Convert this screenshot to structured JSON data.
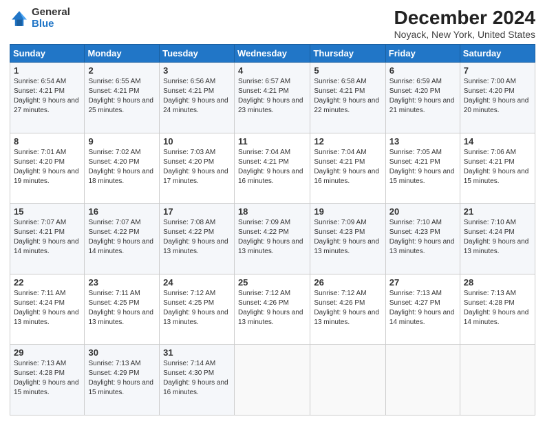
{
  "logo": {
    "general": "General",
    "blue": "Blue"
  },
  "title": "December 2024",
  "subtitle": "Noyack, New York, United States",
  "days_of_week": [
    "Sunday",
    "Monday",
    "Tuesday",
    "Wednesday",
    "Thursday",
    "Friday",
    "Saturday"
  ],
  "weeks": [
    [
      {
        "day": 1,
        "sunrise": "6:54 AM",
        "sunset": "4:21 PM",
        "daylight": "9 hours and 27 minutes."
      },
      {
        "day": 2,
        "sunrise": "6:55 AM",
        "sunset": "4:21 PM",
        "daylight": "9 hours and 25 minutes."
      },
      {
        "day": 3,
        "sunrise": "6:56 AM",
        "sunset": "4:21 PM",
        "daylight": "9 hours and 24 minutes."
      },
      {
        "day": 4,
        "sunrise": "6:57 AM",
        "sunset": "4:21 PM",
        "daylight": "9 hours and 23 minutes."
      },
      {
        "day": 5,
        "sunrise": "6:58 AM",
        "sunset": "4:21 PM",
        "daylight": "9 hours and 22 minutes."
      },
      {
        "day": 6,
        "sunrise": "6:59 AM",
        "sunset": "4:20 PM",
        "daylight": "9 hours and 21 minutes."
      },
      {
        "day": 7,
        "sunrise": "7:00 AM",
        "sunset": "4:20 PM",
        "daylight": "9 hours and 20 minutes."
      }
    ],
    [
      {
        "day": 8,
        "sunrise": "7:01 AM",
        "sunset": "4:20 PM",
        "daylight": "9 hours and 19 minutes."
      },
      {
        "day": 9,
        "sunrise": "7:02 AM",
        "sunset": "4:20 PM",
        "daylight": "9 hours and 18 minutes."
      },
      {
        "day": 10,
        "sunrise": "7:03 AM",
        "sunset": "4:20 PM",
        "daylight": "9 hours and 17 minutes."
      },
      {
        "day": 11,
        "sunrise": "7:04 AM",
        "sunset": "4:21 PM",
        "daylight": "9 hours and 16 minutes."
      },
      {
        "day": 12,
        "sunrise": "7:04 AM",
        "sunset": "4:21 PM",
        "daylight": "9 hours and 16 minutes."
      },
      {
        "day": 13,
        "sunrise": "7:05 AM",
        "sunset": "4:21 PM",
        "daylight": "9 hours and 15 minutes."
      },
      {
        "day": 14,
        "sunrise": "7:06 AM",
        "sunset": "4:21 PM",
        "daylight": "9 hours and 15 minutes."
      }
    ],
    [
      {
        "day": 15,
        "sunrise": "7:07 AM",
        "sunset": "4:21 PM",
        "daylight": "9 hours and 14 minutes."
      },
      {
        "day": 16,
        "sunrise": "7:07 AM",
        "sunset": "4:22 PM",
        "daylight": "9 hours and 14 minutes."
      },
      {
        "day": 17,
        "sunrise": "7:08 AM",
        "sunset": "4:22 PM",
        "daylight": "9 hours and 13 minutes."
      },
      {
        "day": 18,
        "sunrise": "7:09 AM",
        "sunset": "4:22 PM",
        "daylight": "9 hours and 13 minutes."
      },
      {
        "day": 19,
        "sunrise": "7:09 AM",
        "sunset": "4:23 PM",
        "daylight": "9 hours and 13 minutes."
      },
      {
        "day": 20,
        "sunrise": "7:10 AM",
        "sunset": "4:23 PM",
        "daylight": "9 hours and 13 minutes."
      },
      {
        "day": 21,
        "sunrise": "7:10 AM",
        "sunset": "4:24 PM",
        "daylight": "9 hours and 13 minutes."
      }
    ],
    [
      {
        "day": 22,
        "sunrise": "7:11 AM",
        "sunset": "4:24 PM",
        "daylight": "9 hours and 13 minutes."
      },
      {
        "day": 23,
        "sunrise": "7:11 AM",
        "sunset": "4:25 PM",
        "daylight": "9 hours and 13 minutes."
      },
      {
        "day": 24,
        "sunrise": "7:12 AM",
        "sunset": "4:25 PM",
        "daylight": "9 hours and 13 minutes."
      },
      {
        "day": 25,
        "sunrise": "7:12 AM",
        "sunset": "4:26 PM",
        "daylight": "9 hours and 13 minutes."
      },
      {
        "day": 26,
        "sunrise": "7:12 AM",
        "sunset": "4:26 PM",
        "daylight": "9 hours and 13 minutes."
      },
      {
        "day": 27,
        "sunrise": "7:13 AM",
        "sunset": "4:27 PM",
        "daylight": "9 hours and 14 minutes."
      },
      {
        "day": 28,
        "sunrise": "7:13 AM",
        "sunset": "4:28 PM",
        "daylight": "9 hours and 14 minutes."
      }
    ],
    [
      {
        "day": 29,
        "sunrise": "7:13 AM",
        "sunset": "4:28 PM",
        "daylight": "9 hours and 15 minutes."
      },
      {
        "day": 30,
        "sunrise": "7:13 AM",
        "sunset": "4:29 PM",
        "daylight": "9 hours and 15 minutes."
      },
      {
        "day": 31,
        "sunrise": "7:14 AM",
        "sunset": "4:30 PM",
        "daylight": "9 hours and 16 minutes."
      },
      null,
      null,
      null,
      null
    ]
  ],
  "labels": {
    "sunrise": "Sunrise:",
    "sunset": "Sunset:",
    "daylight": "Daylight:"
  }
}
